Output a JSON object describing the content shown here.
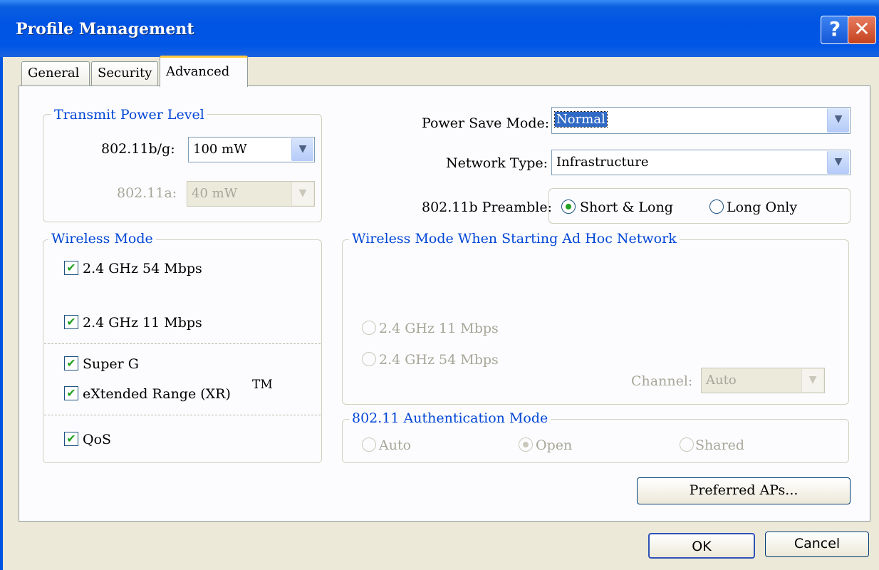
{
  "window": {
    "title": "Profile Management",
    "help_icon": "?",
    "close_icon": "✕"
  },
  "tabs": [
    {
      "label": "General",
      "active": false
    },
    {
      "label": "Security",
      "active": false
    },
    {
      "label": "Advanced",
      "active": true
    }
  ],
  "transmit_power": {
    "legend": "Transmit Power Level",
    "bg_label": "802.11b/g:",
    "bg_value": "100 mW",
    "a_label": "802.11a:",
    "a_value": "40 mW"
  },
  "power_save": {
    "label": "Power Save Mode:",
    "value": "Normal"
  },
  "network_type": {
    "label": "Network Type:",
    "value": "Infrastructure"
  },
  "preamble": {
    "label": "802.11b Preamble:",
    "options": [
      {
        "label": "Short & Long",
        "selected": true
      },
      {
        "label": "Long Only",
        "selected": false
      }
    ]
  },
  "wireless_mode": {
    "legend": "Wireless Mode",
    "items": [
      {
        "label": "2.4 GHz 54 Mbps",
        "checked": true
      },
      {
        "label": "2.4 GHz 11 Mbps",
        "checked": true
      },
      {
        "label": "Super G",
        "checked": true
      },
      {
        "label": "eXtended Range (XR)",
        "checked": true
      },
      {
        "label": "QoS",
        "checked": true
      }
    ],
    "tm_mark": "TM"
  },
  "adhoc_mode": {
    "legend": "Wireless Mode When Starting Ad Hoc Network",
    "options": [
      {
        "label": "2.4 GHz 11 Mbps",
        "selected": false
      },
      {
        "label": "2.4 GHz 54 Mbps",
        "selected": false
      }
    ],
    "channel_label": "Channel:",
    "channel_value": "Auto"
  },
  "auth_mode": {
    "legend": "802.11 Authentication Mode",
    "options": [
      {
        "label": "Auto",
        "selected": false
      },
      {
        "label": "Open",
        "selected": true
      },
      {
        "label": "Shared",
        "selected": false
      }
    ]
  },
  "buttons": {
    "preferred_aps": "Preferred APs...",
    "ok": "OK",
    "cancel": "Cancel"
  },
  "colors": {
    "titlebar": "#0054e3",
    "legend_text": "#0046d5",
    "selection": "#316ac5",
    "check_mark": "#21a121"
  }
}
